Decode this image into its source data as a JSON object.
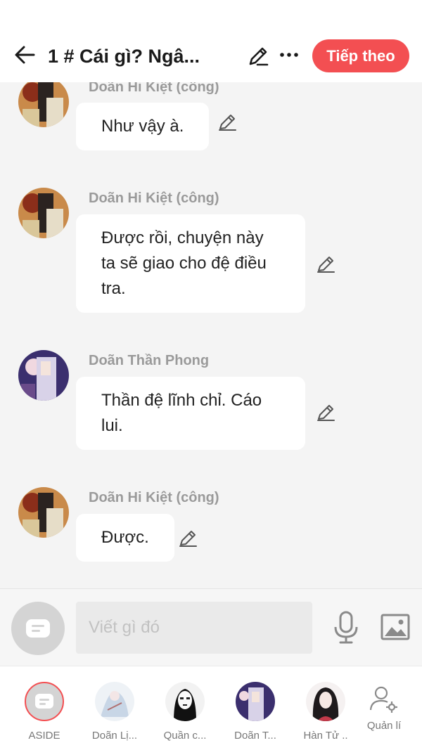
{
  "header": {
    "title": "1 # Cái gì? Ngâ...",
    "next_label": "Tiếp theo"
  },
  "messages": [
    {
      "sender": "Doãn Hi Kiệt (công)",
      "text": "Như vậy à."
    },
    {
      "sender": "Doãn Hi Kiệt (công)",
      "text": "Được rồi, chuyện này ta sẽ giao cho đệ điều tra."
    },
    {
      "sender": "Doãn Thần Phong",
      "text": "Thần đệ lĩnh chỉ. Cáo lui."
    },
    {
      "sender": "Doãn Hi Kiệt (công)",
      "text": "Được."
    }
  ],
  "composer": {
    "placeholder": "Viết gì đó"
  },
  "tabs": [
    {
      "label": "ASIDE",
      "icon": "message-icon",
      "active": true
    },
    {
      "label": "Doãn Lị...",
      "icon": "avatar"
    },
    {
      "label": "Quần c...",
      "icon": "avatar"
    },
    {
      "label": "Doãn T...",
      "icon": "avatar"
    },
    {
      "label": "Hàn Tử ..",
      "icon": "avatar"
    },
    {
      "label": "Quản lí",
      "icon": "user-gear-icon"
    }
  ],
  "colors": {
    "accent": "#f34f52",
    "bubble": "#ffffff",
    "background": "#f4f4f4"
  }
}
